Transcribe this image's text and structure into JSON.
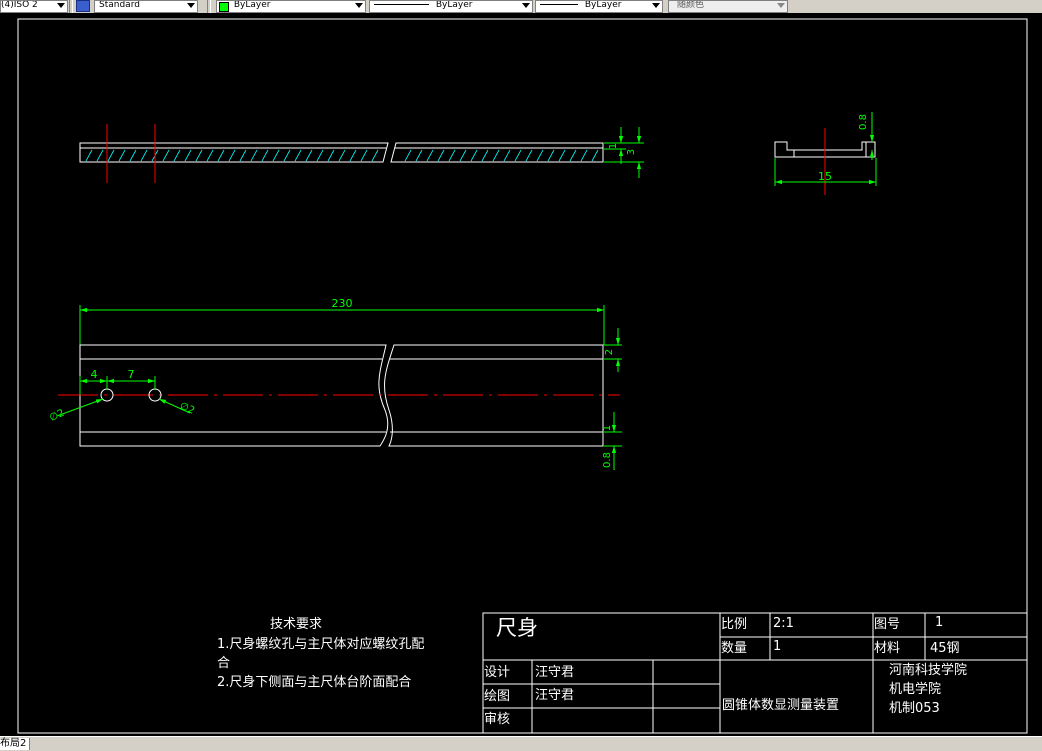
{
  "toolbar": {
    "plot_style": "(4)ISO 2",
    "text_style": "Standard",
    "color": "ByLayer",
    "linetype": "ByLayer",
    "lineweight": "ByLayer",
    "plot_color": "随颜色"
  },
  "colors": {
    "dim": "#00ff00",
    "center": "#ff0000",
    "geometry": "#ffffff",
    "hatch": "#00ffff",
    "background": "#000000"
  },
  "dimensions": {
    "top_view_height_1": "1",
    "top_view_height_3": "3",
    "side_height": "0.8",
    "side_width": "15",
    "length": "230",
    "offset_4": "4",
    "pitch_7": "7",
    "dia_left": "∅2",
    "dia_right": "∅2",
    "front_height_2": "2",
    "front_height_1": "1",
    "front_height_08": "0.8"
  },
  "notes": {
    "title": "技术要求",
    "line1a": "1.尺身螺纹孔与主尺体对应螺纹孔配",
    "line1b": "合",
    "line2": "2.尺身下侧面与主尺体台阶面配合"
  },
  "title_block": {
    "part_name": "尺身",
    "scale_label": "比例",
    "scale_value": "2:1",
    "quantity_label": "数量",
    "quantity_value": "1",
    "drawing_no_label": "图号",
    "drawing_no_value": "1",
    "material_label": "材料",
    "material_value": "45钢",
    "design_label": "设计",
    "design_name": "汪守君",
    "draw_label": "绘图",
    "draw_name": "汪守君",
    "review_label": "审核",
    "project_name": "圆锥体数显测量装置",
    "school": "河南科技学院",
    "department": "机电学院",
    "class": "机制053"
  },
  "status": {
    "layout_tab": "布局2"
  }
}
